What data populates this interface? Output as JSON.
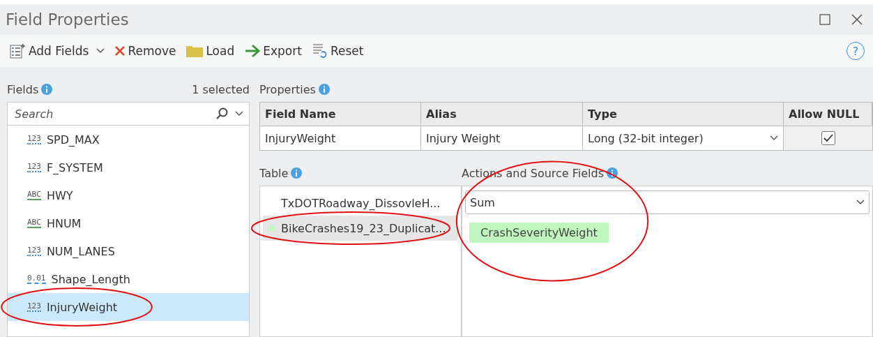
{
  "window": {
    "title": "Field Properties"
  },
  "toolbar": [
    {
      "kind": "add",
      "label": "Add Fields",
      "dropdown": true
    },
    {
      "kind": "remove",
      "label": "Remove",
      "dropdown": false
    },
    {
      "kind": "load",
      "label": "Load",
      "dropdown": false
    },
    {
      "kind": "export",
      "label": "Export",
      "dropdown": false
    },
    {
      "kind": "reset",
      "label": "Reset",
      "dropdown": false
    }
  ],
  "help": {
    "label": "?"
  },
  "fields_panel": {
    "title": "Fields",
    "count": "1 selected",
    "search": {
      "placeholder": "Search"
    },
    "items": [
      {
        "kind": "number",
        "type_label": "123",
        "name": "SPD_MAX",
        "selected": false,
        "circled": false
      },
      {
        "kind": "number",
        "type_label": "123",
        "name": "F_SYSTEM",
        "selected": false,
        "circled": false
      },
      {
        "kind": "text",
        "type_label": "ABC",
        "name": "HWY",
        "selected": false,
        "circled": false
      },
      {
        "kind": "text",
        "type_label": "ABC",
        "name": "HNUM",
        "selected": false,
        "circled": false
      },
      {
        "kind": "number",
        "type_label": "123",
        "name": "NUM_LANES",
        "selected": false,
        "circled": false
      },
      {
        "kind": "decimal",
        "type_label": "0.01",
        "name": "Shape_Length",
        "selected": false,
        "circled": false
      },
      {
        "kind": "number",
        "type_label": "123",
        "name": "InjuryWeight",
        "selected": true,
        "circled": true
      }
    ]
  },
  "properties": {
    "title": "Properties",
    "columns": [
      "Field Name",
      "Alias",
      "Type",
      "Allow NULL"
    ],
    "row": {
      "field_name": "InjuryWeight",
      "alias": "Injury Weight",
      "type": "Long (32-bit integer)",
      "allow_null": true
    }
  },
  "table_panel": {
    "title": "Table",
    "items": [
      {
        "name": "TxDOTRoadway_DissovleH...",
        "selected": false,
        "circled": false
      },
      {
        "name": "BikeCrashes19_23_Duplicat...",
        "selected": true,
        "circled": true
      }
    ]
  },
  "actions_panel": {
    "title": "Actions and Source Fields",
    "action": "Sum",
    "source_fields": [
      "CrashSeverityWeight"
    ],
    "circled": true
  }
}
